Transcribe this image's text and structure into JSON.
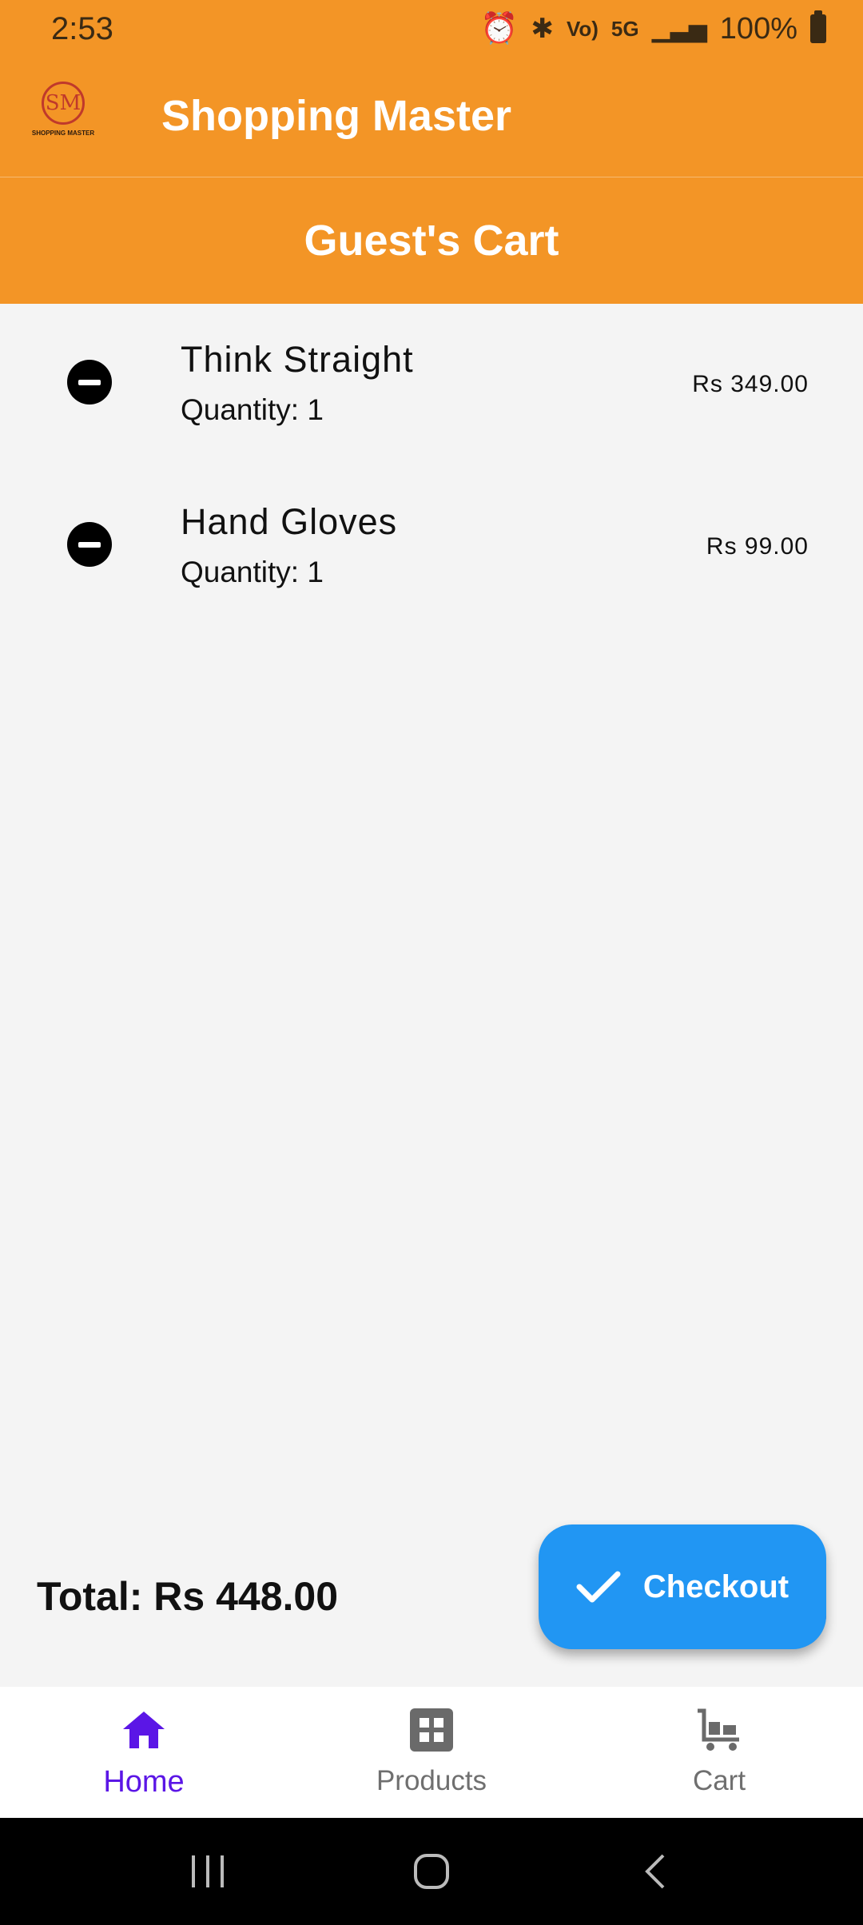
{
  "status_bar": {
    "time": "2:53",
    "volte": "Vo)",
    "network": "5G",
    "battery": "100%"
  },
  "app_bar": {
    "logo_letters": "SM",
    "logo_caption": "SHOPPING MASTER",
    "title": "Shopping Master"
  },
  "cart": {
    "title": "Guest's Cart",
    "items": [
      {
        "name": "Think Straight",
        "quantity": "Quantity: 1",
        "price": "Rs 349.00"
      },
      {
        "name": "Hand Gloves",
        "quantity": "Quantity: 1",
        "price": "Rs 99.00"
      }
    ],
    "total": "Total: Rs 448.00",
    "checkout_label": "Checkout"
  },
  "bottom_nav": {
    "items": [
      {
        "label": "Home",
        "icon": "home-icon",
        "active": true
      },
      {
        "label": "Products",
        "icon": "grid-icon",
        "active": false
      },
      {
        "label": "Cart",
        "icon": "cart-icon",
        "active": false
      }
    ]
  },
  "colors": {
    "primary_orange": "#f39526",
    "checkout_blue": "#2196f3",
    "active_nav": "#5b16e6"
  }
}
